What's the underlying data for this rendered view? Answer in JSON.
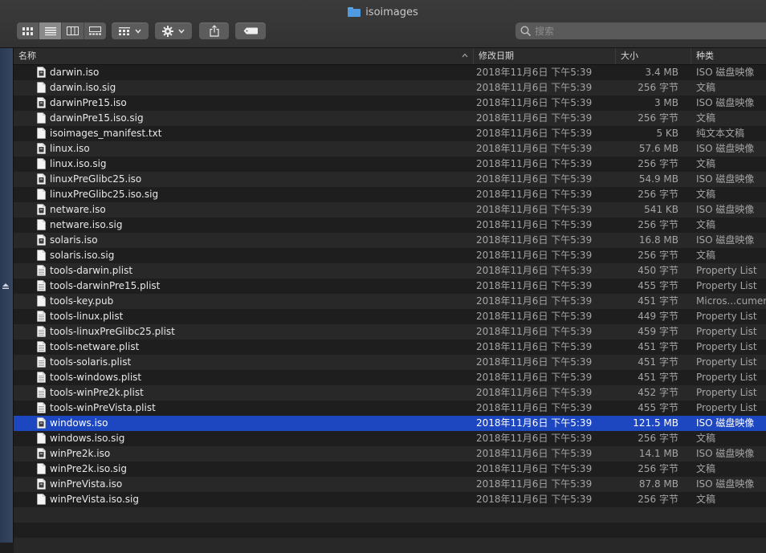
{
  "window": {
    "title": "isoimages"
  },
  "toolbar": {
    "view_icon": "icon-view-grid",
    "list_icon": "list-icon",
    "column_icon": "column-icon",
    "gallery_icon": "gallery-icon",
    "group_icon": "group-by-icon",
    "action_icon": "gear-icon",
    "share_icon": "share-icon",
    "tag_icon": "tag-icon"
  },
  "search": {
    "placeholder": "搜索"
  },
  "columns": {
    "name": "名称",
    "date": "修改日期",
    "size": "大小",
    "kind": "种类"
  },
  "files": [
    {
      "name": "darwin.iso",
      "date": "2018年11月6日 下午5:39",
      "size": "3.4 MB",
      "kind": "ISO 磁盘映像",
      "icon": "iso"
    },
    {
      "name": "darwin.iso.sig",
      "date": "2018年11月6日 下午5:39",
      "size": "256 字节",
      "kind": "文稿",
      "icon": "doc"
    },
    {
      "name": "darwinPre15.iso",
      "date": "2018年11月6日 下午5:39",
      "size": "3 MB",
      "kind": "ISO 磁盘映像",
      "icon": "iso"
    },
    {
      "name": "darwinPre15.iso.sig",
      "date": "2018年11月6日 下午5:39",
      "size": "256 字节",
      "kind": "文稿",
      "icon": "doc"
    },
    {
      "name": "isoimages_manifest.txt",
      "date": "2018年11月6日 下午5:39",
      "size": "5 KB",
      "kind": "纯文本文稿",
      "icon": "doc"
    },
    {
      "name": "linux.iso",
      "date": "2018年11月6日 下午5:39",
      "size": "57.6 MB",
      "kind": "ISO 磁盘映像",
      "icon": "iso"
    },
    {
      "name": "linux.iso.sig",
      "date": "2018年11月6日 下午5:39",
      "size": "256 字节",
      "kind": "文稿",
      "icon": "doc"
    },
    {
      "name": "linuxPreGlibc25.iso",
      "date": "2018年11月6日 下午5:39",
      "size": "54.9 MB",
      "kind": "ISO 磁盘映像",
      "icon": "iso"
    },
    {
      "name": "linuxPreGlibc25.iso.sig",
      "date": "2018年11月6日 下午5:39",
      "size": "256 字节",
      "kind": "文稿",
      "icon": "doc"
    },
    {
      "name": "netware.iso",
      "date": "2018年11月6日 下午5:39",
      "size": "541 KB",
      "kind": "ISO 磁盘映像",
      "icon": "iso"
    },
    {
      "name": "netware.iso.sig",
      "date": "2018年11月6日 下午5:39",
      "size": "256 字节",
      "kind": "文稿",
      "icon": "doc"
    },
    {
      "name": "solaris.iso",
      "date": "2018年11月6日 下午5:39",
      "size": "16.8 MB",
      "kind": "ISO 磁盘映像",
      "icon": "iso"
    },
    {
      "name": "solaris.iso.sig",
      "date": "2018年11月6日 下午5:39",
      "size": "256 字节",
      "kind": "文稿",
      "icon": "doc"
    },
    {
      "name": "tools-darwin.plist",
      "date": "2018年11月6日 下午5:39",
      "size": "450 字节",
      "kind": "Property List",
      "icon": "plist"
    },
    {
      "name": "tools-darwinPre15.plist",
      "date": "2018年11月6日 下午5:39",
      "size": "455 字节",
      "kind": "Property List",
      "icon": "plist"
    },
    {
      "name": "tools-key.pub",
      "date": "2018年11月6日 下午5:39",
      "size": "451 字节",
      "kind": "Micros...cument",
      "icon": "doc"
    },
    {
      "name": "tools-linux.plist",
      "date": "2018年11月6日 下午5:39",
      "size": "449 字节",
      "kind": "Property List",
      "icon": "plist"
    },
    {
      "name": "tools-linuxPreGlibc25.plist",
      "date": "2018年11月6日 下午5:39",
      "size": "459 字节",
      "kind": "Property List",
      "icon": "plist"
    },
    {
      "name": "tools-netware.plist",
      "date": "2018年11月6日 下午5:39",
      "size": "451 字节",
      "kind": "Property List",
      "icon": "plist"
    },
    {
      "name": "tools-solaris.plist",
      "date": "2018年11月6日 下午5:39",
      "size": "451 字节",
      "kind": "Property List",
      "icon": "plist"
    },
    {
      "name": "tools-windows.plist",
      "date": "2018年11月6日 下午5:39",
      "size": "451 字节",
      "kind": "Property List",
      "icon": "plist"
    },
    {
      "name": "tools-winPre2k.plist",
      "date": "2018年11月6日 下午5:39",
      "size": "452 字节",
      "kind": "Property List",
      "icon": "plist"
    },
    {
      "name": "tools-winPreVista.plist",
      "date": "2018年11月6日 下午5:39",
      "size": "455 字节",
      "kind": "Property List",
      "icon": "plist"
    },
    {
      "name": "windows.iso",
      "date": "2018年11月6日 下午5:39",
      "size": "121.5 MB",
      "kind": "ISO 磁盘映像",
      "icon": "iso",
      "selected": true
    },
    {
      "name": "windows.iso.sig",
      "date": "2018年11月6日 下午5:39",
      "size": "256 字节",
      "kind": "文稿",
      "icon": "doc"
    },
    {
      "name": "winPre2k.iso",
      "date": "2018年11月6日 下午5:39",
      "size": "14.1 MB",
      "kind": "ISO 磁盘映像",
      "icon": "iso"
    },
    {
      "name": "winPre2k.iso.sig",
      "date": "2018年11月6日 下午5:39",
      "size": "256 字节",
      "kind": "文稿",
      "icon": "doc"
    },
    {
      "name": "winPreVista.iso",
      "date": "2018年11月6日 下午5:39",
      "size": "87.8 MB",
      "kind": "ISO 磁盘映像",
      "icon": "iso"
    },
    {
      "name": "winPreVista.iso.sig",
      "date": "2018年11月6日 下午5:39",
      "size": "256 字节",
      "kind": "文稿",
      "icon": "doc"
    }
  ],
  "colors": {
    "selection": "#1d46c1",
    "folder": "#4f9ae0"
  }
}
